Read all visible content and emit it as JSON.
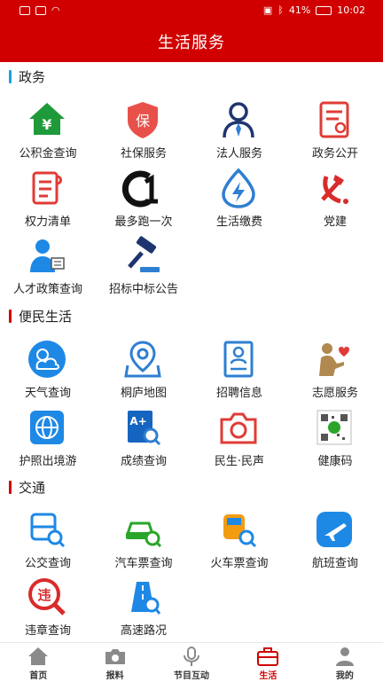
{
  "status_bar": {
    "time": "10:02",
    "battery": "41%"
  },
  "header": {
    "title": "生活服务"
  },
  "sections": [
    {
      "title": "政务",
      "accent": "#1aa0e6",
      "items": [
        {
          "label": "公积金查询",
          "icon": "house-yuan-icon"
        },
        {
          "label": "社保服务",
          "icon": "shield-bao-icon"
        },
        {
          "label": "法人服务",
          "icon": "person-tie-icon"
        },
        {
          "label": "政务公开",
          "icon": "document-icon"
        },
        {
          "label": "权力清单",
          "icon": "scroll-list-icon"
        },
        {
          "label": "最多跑一次",
          "icon": "run-once-icon"
        },
        {
          "label": "生活缴费",
          "icon": "utility-drop-icon"
        },
        {
          "label": "党建",
          "icon": "party-emblem-icon"
        },
        {
          "label": "人才政策查询",
          "icon": "talent-icon"
        },
        {
          "label": "招标中标公告",
          "icon": "gavel-icon"
        }
      ]
    },
    {
      "title": "便民生活",
      "accent": "#d10000",
      "items": [
        {
          "label": "天气查询",
          "icon": "weather-icon"
        },
        {
          "label": "桐庐地图",
          "icon": "map-pin-icon"
        },
        {
          "label": "招聘信息",
          "icon": "resume-icon"
        },
        {
          "label": "志愿服务",
          "icon": "volunteer-icon"
        },
        {
          "label": "护照出境游",
          "icon": "globe-icon"
        },
        {
          "label": "成绩查询",
          "icon": "grade-search-icon"
        },
        {
          "label": "民生·民声",
          "icon": "camera-icon"
        },
        {
          "label": "健康码",
          "icon": "qr-code-icon"
        }
      ]
    },
    {
      "title": "交通",
      "accent": "#d10000",
      "items": [
        {
          "label": "公交查询",
          "icon": "bus-search-icon"
        },
        {
          "label": "汽车票查询",
          "icon": "car-search-icon"
        },
        {
          "label": "火车票查询",
          "icon": "train-search-icon"
        },
        {
          "label": "航班查询",
          "icon": "plane-icon"
        },
        {
          "label": "违章查询",
          "icon": "violation-icon"
        },
        {
          "label": "高速路况",
          "icon": "highway-icon"
        }
      ]
    }
  ],
  "bottom_nav": [
    {
      "label": "首页",
      "icon": "home-icon"
    },
    {
      "label": "报料",
      "icon": "camera-icon"
    },
    {
      "label": "节目互动",
      "icon": "microphone-icon"
    },
    {
      "label": "生活",
      "icon": "briefcase-icon",
      "active": true
    },
    {
      "label": "我的",
      "icon": "user-icon"
    }
  ],
  "colors": {
    "brand_red": "#d10000",
    "icon_blue": "#2e7fd1",
    "icon_green": "#2aa52a",
    "icon_red": "#e03b36",
    "icon_navy": "#1f3570"
  }
}
